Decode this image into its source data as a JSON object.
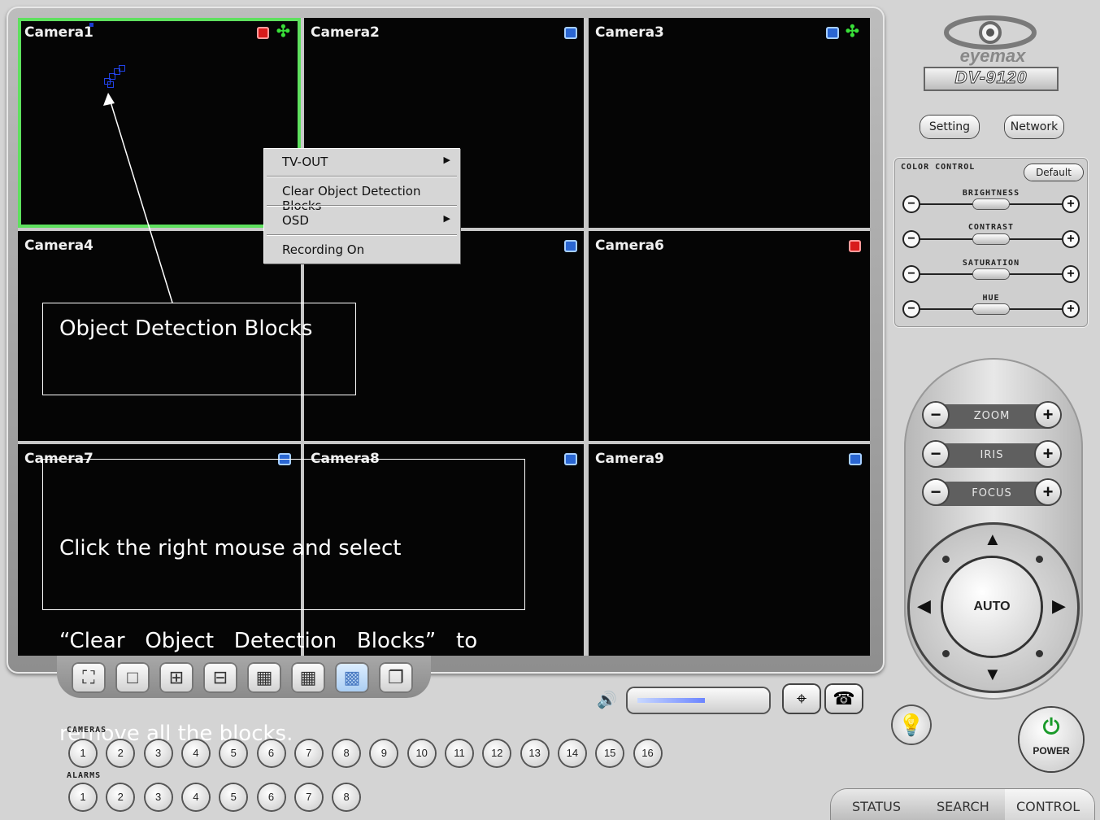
{
  "logo": {
    "brand": "eyemax",
    "model": "DV-9120"
  },
  "cameras": [
    {
      "label": "Camera1"
    },
    {
      "label": "Camera2"
    },
    {
      "label": "Camera3"
    },
    {
      "label": "Camera4"
    },
    {
      "label": ""
    },
    {
      "label": "Camera6"
    },
    {
      "label": "Camera7"
    },
    {
      "label": "Camera8"
    },
    {
      "label": "Camera9"
    }
  ],
  "context_menu": [
    {
      "label": "TV-OUT",
      "submenu": true
    },
    {
      "label": "Clear Object Detection Blocks",
      "submenu": false
    },
    {
      "label": "OSD",
      "submenu": true
    },
    {
      "label": "Recording On",
      "submenu": false
    }
  ],
  "annotations": {
    "blocks_callout": "Object Detection Blocks",
    "instruction_line1": "Click the right mouse and select",
    "instruction_line2": "“Clear   Object   Detection   Blocks”   to",
    "instruction_line3": "remove all the blocks."
  },
  "top_buttons": {
    "setting": "Setting",
    "network": "Network"
  },
  "color_control": {
    "title": "COLOR CONTROL",
    "default_label": "Default",
    "sliders": [
      {
        "label": "BRIGHTNESS",
        "value": 0.5
      },
      {
        "label": "CONTRAST",
        "value": 0.5
      },
      {
        "label": "SATURATION",
        "value": 0.5
      },
      {
        "label": "HUE",
        "value": 0.5
      }
    ]
  },
  "ptz": {
    "zoom": "ZOOM",
    "iris": "IRIS",
    "focus": "FOCUS",
    "auto": "AUTO"
  },
  "power_label": "POWER",
  "cameras_label": "CAMERAS",
  "alarms_label": "ALARMS",
  "camera_buttons": [
    "1",
    "2",
    "3",
    "4",
    "5",
    "6",
    "7",
    "8",
    "9",
    "10",
    "11",
    "12",
    "13",
    "14",
    "15",
    "16"
  ],
  "alarm_buttons": [
    "1",
    "2",
    "3",
    "4",
    "5",
    "6",
    "7",
    "8"
  ],
  "tabs": [
    "STATUS",
    "SEARCH",
    "CONTROL"
  ],
  "volume_level": 0.55,
  "active_layout_index": 6,
  "colors": {
    "selected_border": "#5ee05e",
    "active_layout": "#a8ccf2"
  }
}
